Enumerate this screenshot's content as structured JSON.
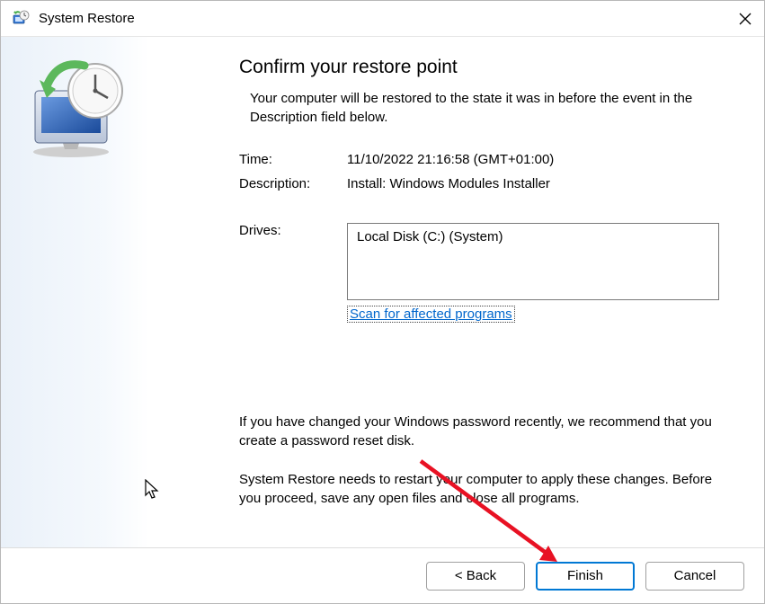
{
  "window": {
    "title": "System Restore"
  },
  "content": {
    "heading": "Confirm your restore point",
    "subheading": "Your computer will be restored to the state it was in before the event in the Description field below.",
    "time_label": "Time:",
    "time_value": "11/10/2022 21:16:58 (GMT+01:00)",
    "description_label": "Description:",
    "description_value": "Install: Windows Modules Installer",
    "drives_label": "Drives:",
    "drives_value": "Local Disk (C:) (System)",
    "scan_link": "Scan for affected programs",
    "warning_password": "If you have changed your Windows password recently, we recommend that you create a password reset disk.",
    "warning_restart": "System Restore needs to restart your computer to apply these changes. Before you proceed, save any open files and close all programs."
  },
  "footer": {
    "back_label": "< Back",
    "finish_label": "Finish",
    "cancel_label": "Cancel"
  }
}
